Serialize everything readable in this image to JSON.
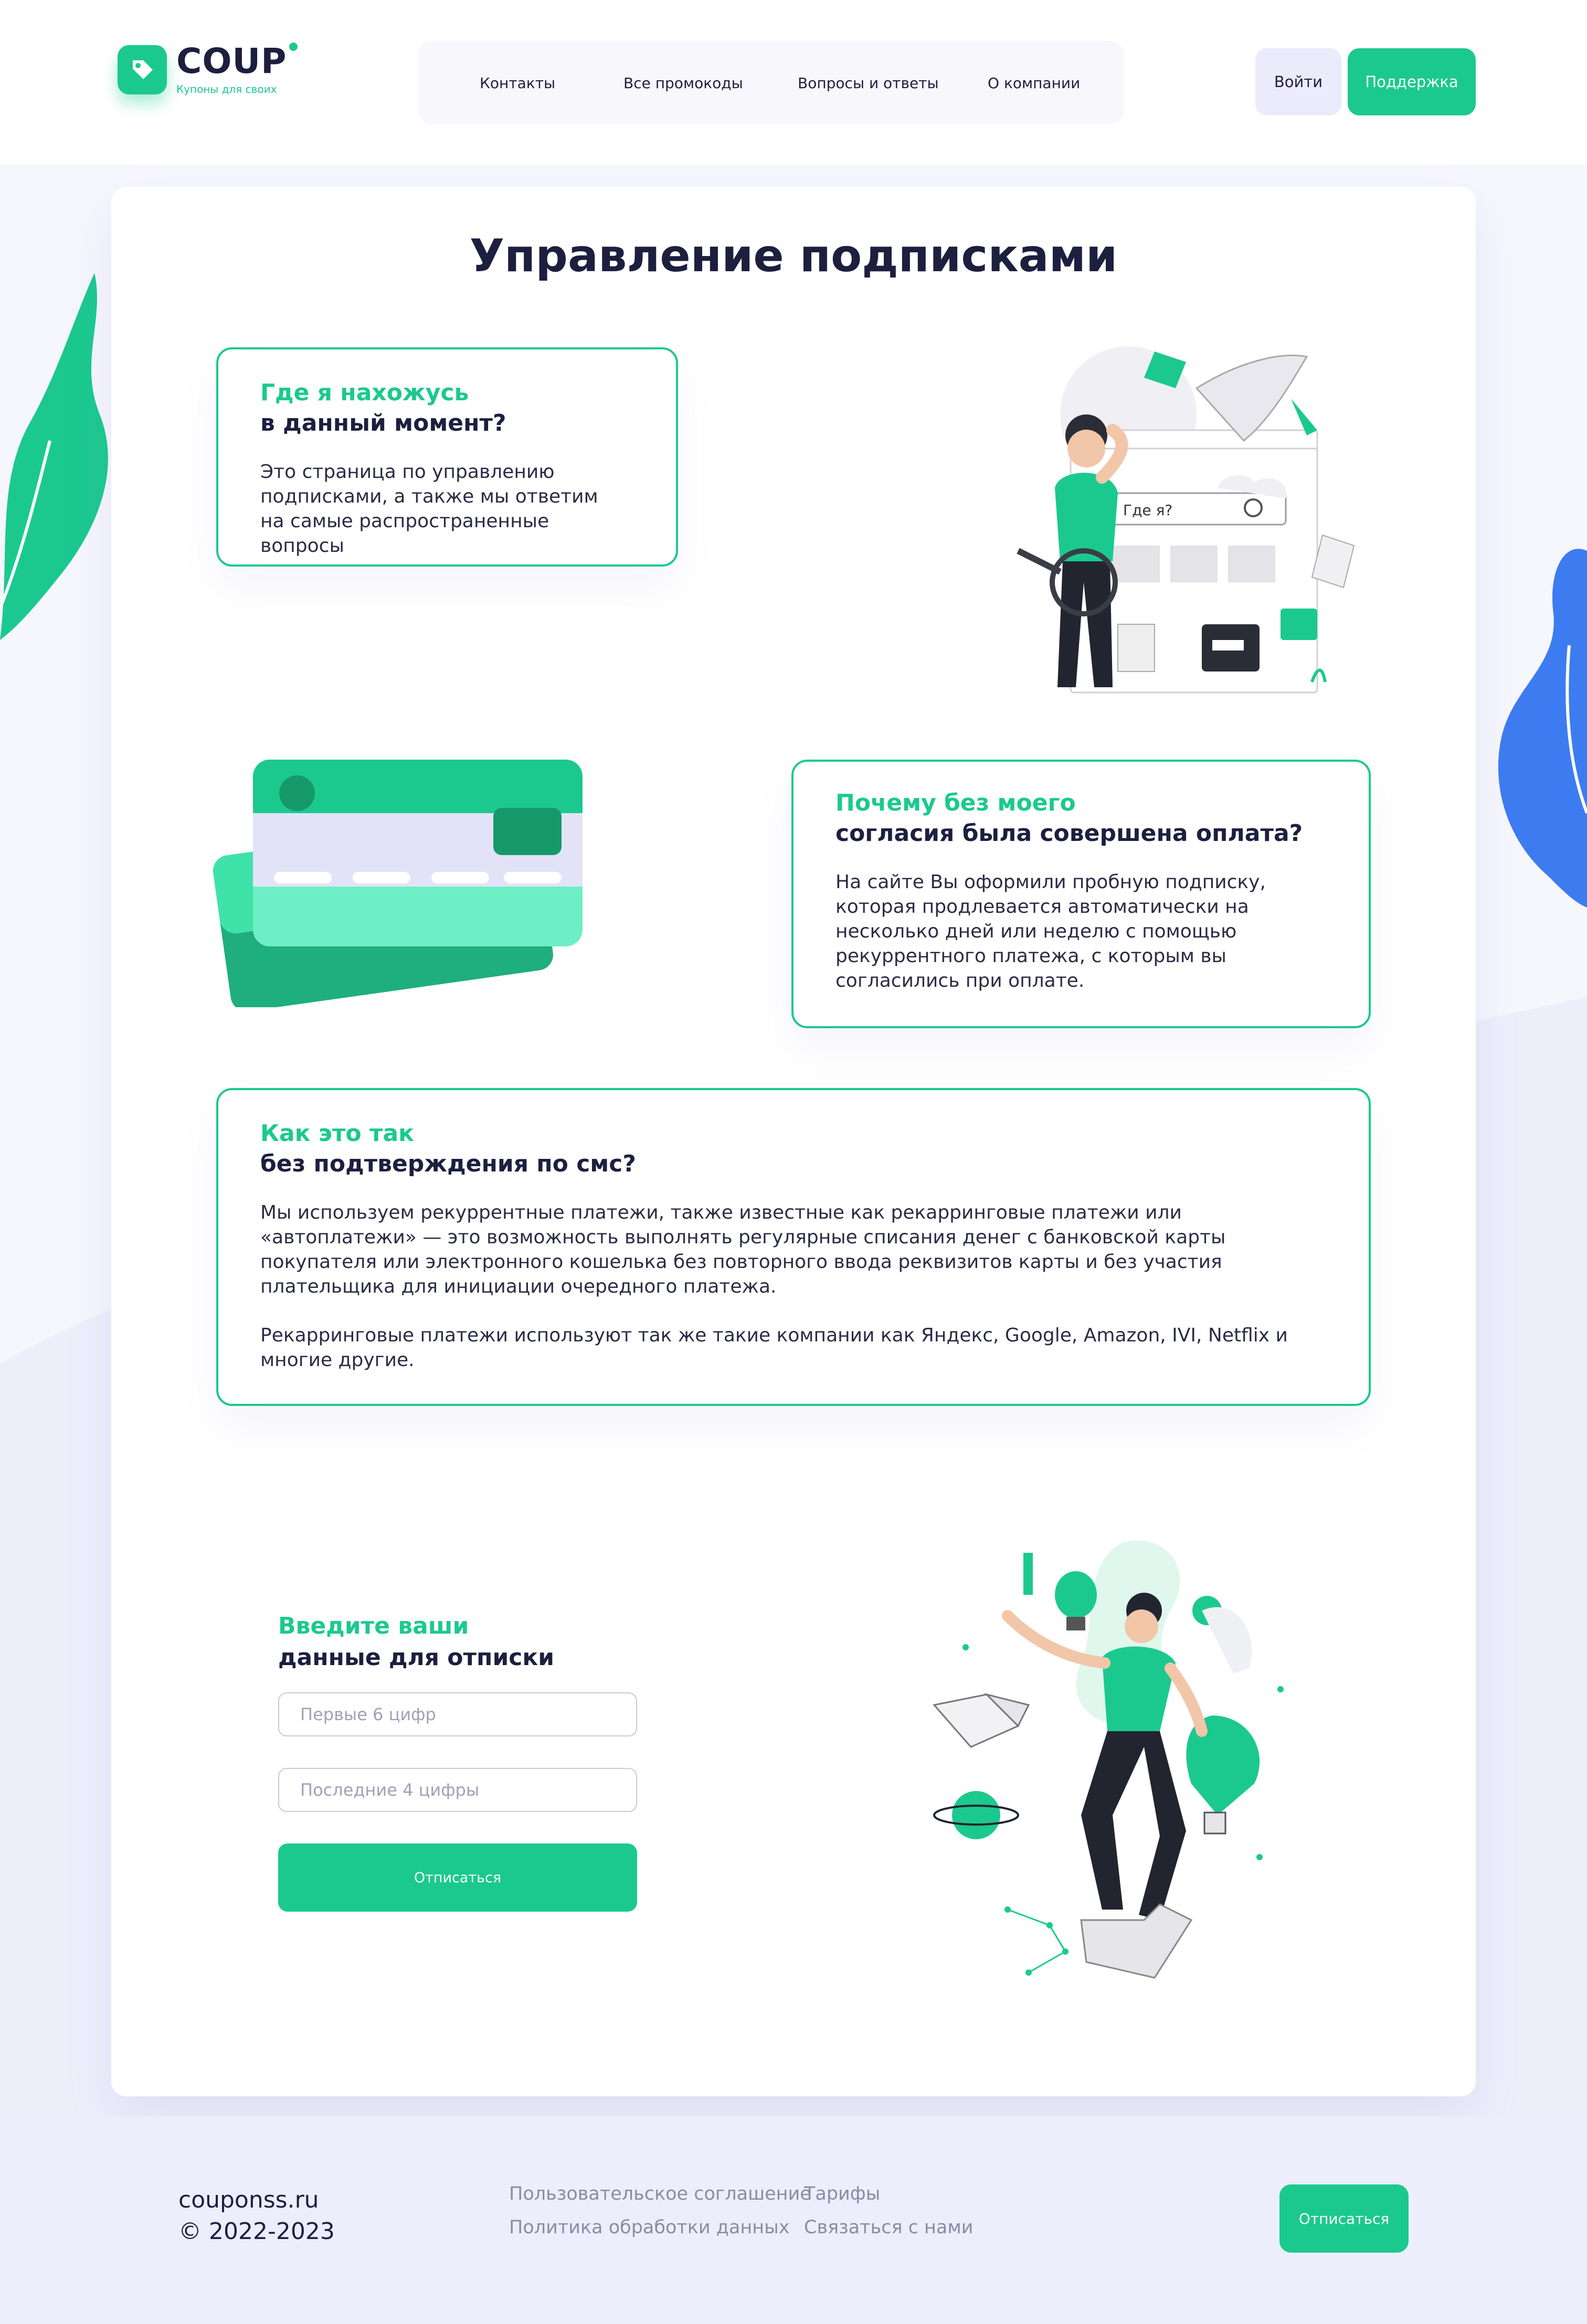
{
  "brand": {
    "name": "COUP",
    "tagline": "Купоны для своих",
    "accent_color": "#1bc98e",
    "dark_color": "#1d1f3f"
  },
  "nav": {
    "items": [
      "Контакты",
      "Все промокоды",
      "Вопросы и ответы",
      "О компании"
    ]
  },
  "header": {
    "login_label": "Войти",
    "support_label": "Поддержка"
  },
  "page_title": "Управление подписками",
  "faq": [
    {
      "title_green": "Где я нахожусь",
      "title_dark": "в данный момент?",
      "text": "Это страница по управлению подписками, а также мы ответим на самые распространенные вопросы"
    },
    {
      "title_green": "Почему без моего",
      "title_dark": "согласия была совершена оплата?",
      "text": "На сайте Вы оформили пробную подписку, которая продлевается автоматически на несколько дней или неделю с помощью рекуррентного платежа, с которым вы согласились при оплате."
    },
    {
      "title_green": "Как это так",
      "title_dark": "без подтверждения по смс?",
      "text": "Мы используем рекуррентные платежи, также известные как рекарринговые платежи или «автоплатежи» — это возможность выполнять регулярные списания денег с банковской карты покупателя или электронного кошелька без повторного ввода реквизитов карты и без участия плательщика для инициации очередного платежа.",
      "text2": "Рекарринговые платежи используют так же такие компании как Яндекс, Google, Amazon, IVI, Netflix и многие другие."
    }
  ],
  "illustration1": {
    "search_label": "Где я?"
  },
  "form": {
    "title_green": "Введите ваши",
    "title_dark": "данные для отписки",
    "first_placeholder": "Первые 6 цифр",
    "last_placeholder": "Последние 4 цифры",
    "submit_label": "Отписаться"
  },
  "footer": {
    "domain": "couponss.ru",
    "copyright": "© 2022-2023",
    "links": [
      "Пользовательское соглашение",
      "Тарифы",
      "Политика обработки данных",
      "Связаться с нами"
    ],
    "button_label": "Отписаться"
  }
}
